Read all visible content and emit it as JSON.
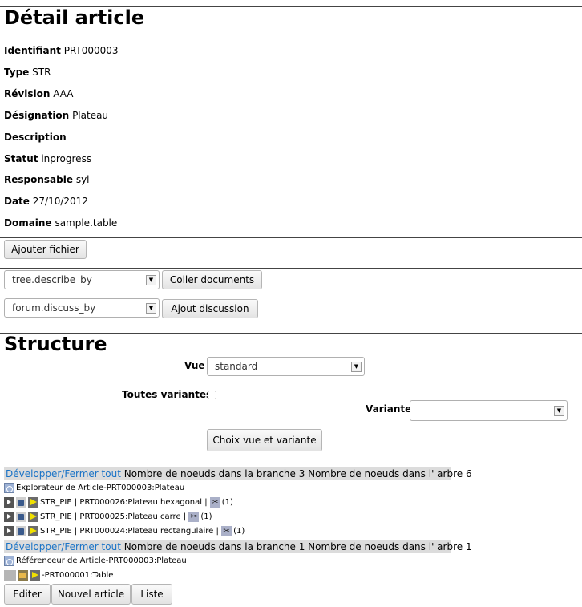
{
  "page": {
    "title": "Détail article",
    "fields": [
      {
        "label": "Identifiant",
        "value": "PRT000003"
      },
      {
        "label": "Type",
        "value": "STR"
      },
      {
        "label": "Révision",
        "value": "AAA"
      },
      {
        "label": "Désignation",
        "value": "Plateau"
      },
      {
        "label": "Description",
        "value": ""
      },
      {
        "label": "Statut",
        "value": "inprogress"
      },
      {
        "label": "Responsable",
        "value": "syl"
      },
      {
        "label": "Date",
        "value": "27/10/2012"
      },
      {
        "label": "Domaine",
        "value": "sample.table"
      }
    ],
    "add_file_button": "Ajouter fichier"
  },
  "links": {
    "tree_select": "tree.describe_by",
    "paste_button": "Coller documents",
    "forum_select": "forum.discuss_by",
    "discussion_button": "Ajout discussion"
  },
  "structure": {
    "title": "Structure",
    "vue_label": "Vue",
    "vue_value": "standard",
    "variants_label": "Toutes variantes",
    "variant_label": "Variante",
    "variant_value": "",
    "choose_button": "Choix vue et variante"
  },
  "explorer": {
    "toggle_link": "Développer/Fermer tout",
    "stats": "Nombre de noeuds dans la branche 3 Nombre de noeuds dans l' arbre 6",
    "root": "Explorateur de Article-PRT000003:Plateau",
    "children": [
      {
        "label": "STR_PIE | PRT000026:Plateau hexagonal |",
        "count": "(1)"
      },
      {
        "label": "STR_PIE | PRT000025:Plateau carre |",
        "count": "(1)"
      },
      {
        "label": "STR_PIE | PRT000024:Plateau rectangulaire |",
        "count": "(1)"
      }
    ]
  },
  "referencer": {
    "toggle_link": "Développer/Fermer tout",
    "stats": "Nombre de noeuds dans la branche 1 Nombre de noeuds dans l' arbre 1",
    "root": "Référenceur de Article-PRT000003:Plateau",
    "child": "-PRT000001:Table"
  },
  "actions": {
    "edit": "Editer",
    "new_article": "Nouvel article",
    "list": "Liste"
  }
}
